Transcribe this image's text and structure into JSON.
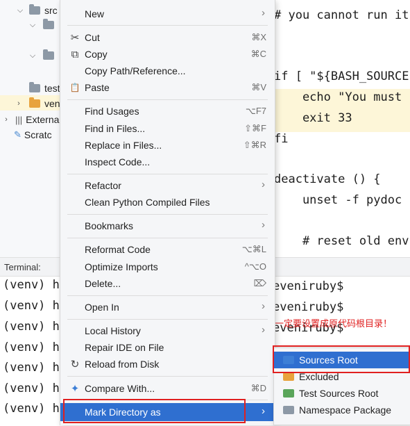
{
  "tree": {
    "rows": [
      {
        "label": "src"
      },
      {
        "label": ""
      },
      {
        "label": ""
      },
      {
        "label": "test"
      },
      {
        "label": "ven"
      },
      {
        "label": "Externa"
      },
      {
        "label": "Scratc"
      }
    ]
  },
  "editor": {
    "lines": [
      "# you cannot run it",
      "if [ \"${BASH_SOURCE",
      "    echo \"You must",
      "    exit 33",
      "fi",
      "deactivate () {",
      "    unset -f pydoc",
      "    # reset old env"
    ]
  },
  "terminal": {
    "tab_label": "Terminal:",
    "prompt": "(venv) h",
    "right_lines": [
      "eveniruby$",
      "eveniruby$",
      "eveniruby$"
    ],
    "annotation": "一定要设置成原代码根目录！"
  },
  "context_menu": {
    "items": [
      {
        "label": "New",
        "shortcut": "",
        "submenu": true,
        "icon": ""
      },
      {
        "label": "Cut",
        "shortcut": "⌘X",
        "submenu": false,
        "icon": "✂"
      },
      {
        "label": "Copy",
        "shortcut": "⌘C",
        "submenu": false,
        "icon": "⧉"
      },
      {
        "label": "Copy Path/Reference...",
        "shortcut": "",
        "submenu": false,
        "icon": ""
      },
      {
        "label": "Paste",
        "shortcut": "⌘V",
        "submenu": false,
        "icon": "📋"
      },
      {
        "label": "Find Usages",
        "shortcut": "⌥F7",
        "submenu": false,
        "icon": ""
      },
      {
        "label": "Find in Files...",
        "shortcut": "⇧⌘F",
        "submenu": false,
        "icon": ""
      },
      {
        "label": "Replace in Files...",
        "shortcut": "⇧⌘R",
        "submenu": false,
        "icon": ""
      },
      {
        "label": "Inspect Code...",
        "shortcut": "",
        "submenu": false,
        "icon": ""
      },
      {
        "label": "Refactor",
        "shortcut": "",
        "submenu": true,
        "icon": ""
      },
      {
        "label": "Clean Python Compiled Files",
        "shortcut": "",
        "submenu": false,
        "icon": ""
      },
      {
        "label": "Bookmarks",
        "shortcut": "",
        "submenu": true,
        "icon": ""
      },
      {
        "label": "Reformat Code",
        "shortcut": "⌥⌘L",
        "submenu": false,
        "icon": ""
      },
      {
        "label": "Optimize Imports",
        "shortcut": "^⌥O",
        "submenu": false,
        "icon": ""
      },
      {
        "label": "Delete...",
        "shortcut": "⌦",
        "submenu": false,
        "icon": ""
      },
      {
        "label": "Open In",
        "shortcut": "",
        "submenu": true,
        "icon": ""
      },
      {
        "label": "Local History",
        "shortcut": "",
        "submenu": true,
        "icon": ""
      },
      {
        "label": "Repair IDE on File",
        "shortcut": "",
        "submenu": false,
        "icon": ""
      },
      {
        "label": "Reload from Disk",
        "shortcut": "",
        "submenu": false,
        "icon": "↻"
      },
      {
        "label": "Compare With...",
        "shortcut": "⌘D",
        "submenu": false,
        "icon": "✦"
      },
      {
        "label": "Mark Directory as",
        "shortcut": "",
        "submenu": true,
        "icon": ""
      }
    ]
  },
  "submenu": {
    "items": [
      {
        "label": "Sources Root",
        "color": "#3d7fd6"
      },
      {
        "label": "Excluded",
        "color": "#e8a33d"
      },
      {
        "label": "Test Sources Root",
        "color": "#5aa55a"
      },
      {
        "label": "Namespace Package",
        "color": "#8d99a6"
      }
    ]
  }
}
